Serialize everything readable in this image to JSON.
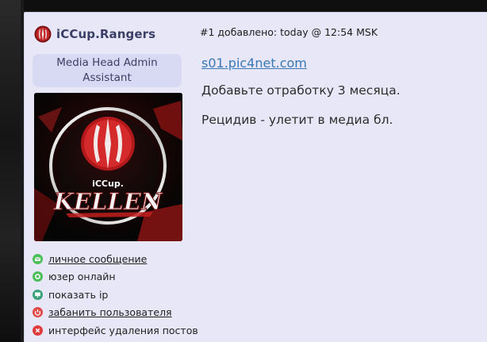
{
  "user": {
    "name": "iCCup.Rangers",
    "title": "Media Head Admin Assistant",
    "avatar_text_top": "iCCup.",
    "avatar_text_main": "KELLEN"
  },
  "actions": [
    {
      "label": "личное сообщение",
      "link": true,
      "icon": "envelope-icon",
      "color": "#4cbf58"
    },
    {
      "label": "юзер онлайн",
      "link": false,
      "icon": "online-icon",
      "color": "#4cbf58"
    },
    {
      "label": "показать ip",
      "link": false,
      "icon": "monitor-icon",
      "color": "#3aa27a"
    },
    {
      "label": "забанить пользователя",
      "link": true,
      "icon": "power-icon",
      "color": "#e04848"
    },
    {
      "label": "интерфейс удаления постов",
      "link": false,
      "icon": "delete-icon",
      "color": "#e03c3c"
    }
  ],
  "post": {
    "meta": "#1 добавлено: today @ 12:54 MSK",
    "link_text": "s01.pic4net.com",
    "line1": "Добавьте отработку 3 месяца.",
    "line2": "Рецидив - улетит в медиа бл."
  },
  "colors": {
    "post_bg": "#e7e7f8",
    "badge_bg": "#d8d9f2",
    "username": "#3b3f66",
    "link": "#3a78b5"
  }
}
